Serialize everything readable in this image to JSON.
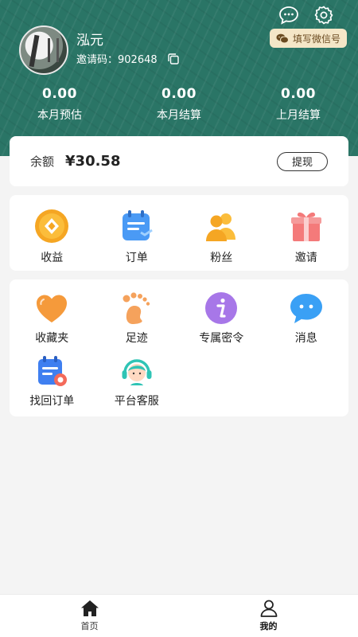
{
  "profile": {
    "name": "泓元",
    "invite_label": "邀请码：",
    "invite_code": "902648",
    "wechat_chip": "填写微信号"
  },
  "stats": [
    {
      "value": "0.00",
      "label": "本月预估"
    },
    {
      "value": "0.00",
      "label": "本月结算"
    },
    {
      "value": "0.00",
      "label": "上月结算"
    }
  ],
  "balance": {
    "label": "余额",
    "amount": "¥30.58",
    "withdraw": "提现"
  },
  "quick_menu": [
    {
      "label": "收益",
      "icon": "coin-icon"
    },
    {
      "label": "订单",
      "icon": "order-icon"
    },
    {
      "label": "粉丝",
      "icon": "fans-icon"
    },
    {
      "label": "邀请",
      "icon": "gift-icon"
    }
  ],
  "tools": [
    {
      "label": "收藏夹",
      "icon": "heart-icon"
    },
    {
      "label": "足迹",
      "icon": "footprint-icon"
    },
    {
      "label": "专属密令",
      "icon": "info-icon"
    },
    {
      "label": "消息",
      "icon": "chat-bubble-icon"
    },
    {
      "label": "找回订单",
      "icon": "find-order-icon"
    },
    {
      "label": "平台客服",
      "icon": "customer-service-icon"
    }
  ],
  "bottom_nav": [
    {
      "label": "首页",
      "icon": "home-icon"
    },
    {
      "label": "我的",
      "icon": "user-icon"
    }
  ],
  "colors": {
    "header_bg": "#2a7566",
    "chip_bg": "#f4e6c7",
    "card_bg": "#ffffff",
    "page_bg": "#f4f4f4"
  }
}
